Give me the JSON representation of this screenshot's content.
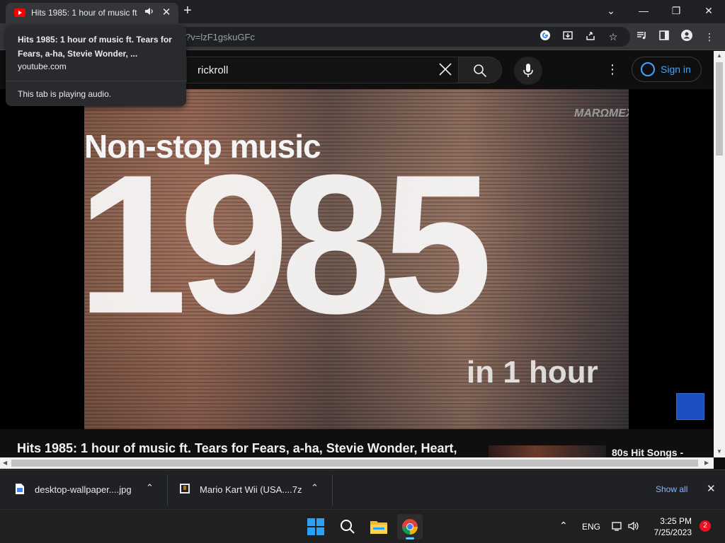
{
  "browser": {
    "tab": {
      "title": "Hits 1985: 1 hour of music ft. Tears for Fears, a-ha, Stevie Wonder, Heart,",
      "audio_icon": "volume-icon",
      "close_glyph": "✕"
    },
    "new_tab_glyph": "+",
    "window_controls": {
      "tab_search": "⌄",
      "minimize": "—",
      "restore": "❐",
      "close": "✕"
    },
    "url": "?v=lzF1gskuGFc",
    "toolbar_icons": [
      "google-lens-icon",
      "install-icon",
      "share-icon",
      "bookmark-star-icon",
      "media-controls-icon",
      "side-panel-icon",
      "profile-icon",
      "menu-icon"
    ]
  },
  "hover_card": {
    "title": "Hits 1985: 1 hour of music ft. Tears for Fears, a-ha, Stevie Wonder, ...",
    "domain": "youtube.com",
    "audio_status": "This tab is playing audio."
  },
  "youtube": {
    "search_query": "rickroll",
    "clear_glyph": "✕",
    "more_glyph": "⋮",
    "sign_in_label": "Sign in",
    "accent": "#3ea6ff"
  },
  "video": {
    "overlay_line1": "Non-stop music",
    "overlay_year": "1985",
    "overlay_line3": "in 1 hour",
    "channel_logo": "MARΩMEX",
    "title": "Hits 1985: 1 hour of music ft. Tears for Fears, a-ha, Stevie Wonder, Heart,",
    "sidebar_title": "80s Hit Songs -"
  },
  "downloads": {
    "items": [
      {
        "name": "desktop-wallpaper....jpg",
        "icon": "image-file-icon"
      },
      {
        "name": "Mario Kart Wii (USA....7z",
        "icon": "archive-file-icon"
      }
    ],
    "chevron_glyph": "⌃",
    "show_all": "Show all",
    "close_glyph": "✕"
  },
  "taskbar": {
    "apps": [
      "windows-start-icon",
      "search-icon",
      "file-explorer-icon",
      "chrome-icon"
    ],
    "language": "ENG",
    "time": "3:25 PM",
    "date": "7/25/2023",
    "notification_count": "2"
  }
}
